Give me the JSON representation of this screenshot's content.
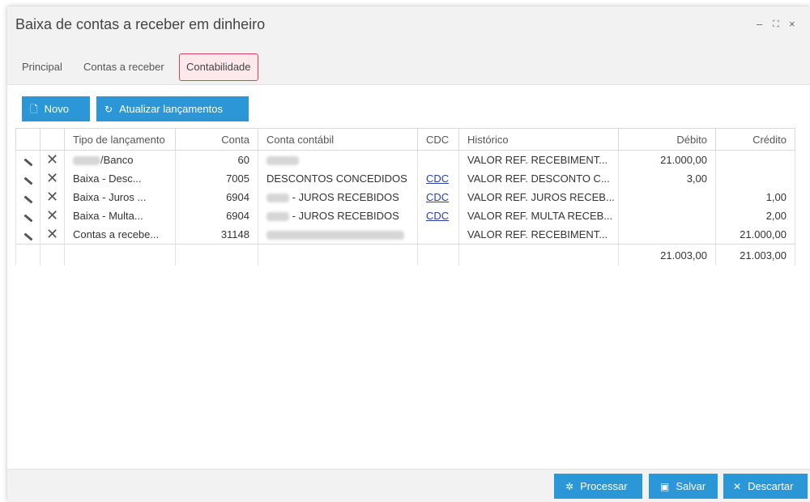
{
  "window": {
    "title": "Baixa de contas a receber em dinheiro",
    "controls": {
      "minimize": "–",
      "maximize": "⛶",
      "close": "×"
    }
  },
  "tabs": [
    {
      "label": "Principal",
      "active": false
    },
    {
      "label": "Contas a receber",
      "active": false
    },
    {
      "label": "Contabilidade",
      "active": true
    }
  ],
  "toolbar": {
    "novo_label": "Novo",
    "atualizar_label": "Atualizar lançamentos"
  },
  "grid": {
    "columns": [
      "",
      "",
      "Tipo de lançamento",
      "Conta",
      "Conta contábil",
      "CDC",
      "Histórico",
      "Débito",
      "Crédito"
    ],
    "rows": [
      {
        "tipo": "/Banco",
        "conta": "60",
        "conta_contabil": "",
        "cdc": "",
        "historico": "VALOR REF. RECEBIMENT...",
        "debito": "21.000,00",
        "credito": ""
      },
      {
        "tipo": "Baixa   - Desc...",
        "conta": "7005",
        "conta_contabil": "DESCONTOS CONCEDIDOS",
        "cdc": "CDC",
        "historico": "VALOR REF. DESCONTO C...",
        "debito": "3,00",
        "credito": ""
      },
      {
        "tipo": "Baixa   - Juros ...",
        "conta": "6904",
        "conta_contabil": "- JUROS RECEBIDOS",
        "cdc": "CDC",
        "historico": "VALOR REF. JUROS RECEB...",
        "debito": "",
        "credito": "1,00"
      },
      {
        "tipo": "Baixa   - Multa...",
        "conta": "6904",
        "conta_contabil": "- JUROS RECEBIDOS",
        "cdc": "CDC",
        "historico": "VALOR REF. MULTA RECEB...",
        "debito": "",
        "credito": "2,00"
      },
      {
        "tipo": "Contas a recebe...",
        "conta": "31148",
        "conta_contabil": "",
        "cdc": "",
        "historico": "VALOR REF. RECEBIMENT...",
        "debito": "",
        "credito": "21.000,00"
      }
    ],
    "totals": {
      "debito": "21.003,00",
      "credito": "21.003,00"
    }
  },
  "footer": {
    "processar_label": "Processar",
    "salvar_label": "Salvar",
    "descartar_label": "Descartar"
  },
  "colors": {
    "accent": "#2b97d6",
    "active_tab_border": "#d9435c",
    "link": "#2a3fa0"
  }
}
